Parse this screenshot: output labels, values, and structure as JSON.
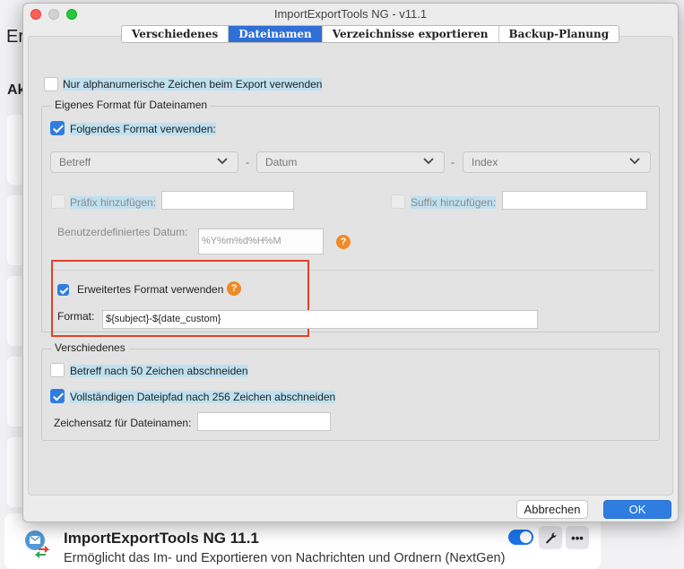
{
  "background_app": {
    "title_fragment": "Er",
    "section_fragment": "Ak",
    "addon": {
      "name": "ImportExportTools NG 11.1",
      "description": "Ermöglicht das Im- und Exportieren von Nachrichten und Ordnern (NextGen)",
      "enabled": true,
      "more_label": "•••"
    }
  },
  "window": {
    "title": "ImportExportTools NG - v11.1",
    "tabs": [
      {
        "label": "Verschiedenes",
        "active": false
      },
      {
        "label": "Dateinamen",
        "active": true
      },
      {
        "label": "Verzeichnisse exportieren",
        "active": false
      },
      {
        "label": "Backup-Planung",
        "active": false
      }
    ]
  },
  "dateinamen": {
    "alphanumeric_label": "Nur alphanumerische Zeichen beim Export verwenden",
    "alphanumeric_checked": false,
    "custom_format": {
      "legend": "Eigenes Format für Dateinamen",
      "use_format_label": "Folgendes Format verwenden:",
      "use_format_checked": true,
      "selects": [
        "Betreff",
        "Datum",
        "Index"
      ],
      "separator": "-",
      "prefix_label": "Präfix hinzufügen:",
      "prefix_value": "",
      "suffix_label": "Suffix hinzufügen:",
      "suffix_value": "",
      "custom_date_label": "Benutzerdefiniertes Datum:",
      "custom_date_value": "%Y%m%d%H%M",
      "extended_label": "Erweitertes Format verwenden",
      "extended_checked": true,
      "format_label": "Format:",
      "format_value": "${subject}-${date_custom}",
      "help_glyph": "?"
    },
    "misc": {
      "legend": "Verschiedenes",
      "truncate_subject_label": "Betreff nach 50 Zeichen abschneiden",
      "truncate_subject_checked": false,
      "truncate_path_label": "Vollständigen Dateipfad nach 256 Zeichen abschneiden",
      "truncate_path_checked": true,
      "charset_label": "Zeichensatz für Dateinamen:",
      "charset_value": ""
    }
  },
  "buttons": {
    "cancel": "Abbrechen",
    "ok": "OK"
  },
  "colors": {
    "accent": "#2f7de1",
    "help": "#f08a24",
    "highlight_box": "#e2412a"
  }
}
